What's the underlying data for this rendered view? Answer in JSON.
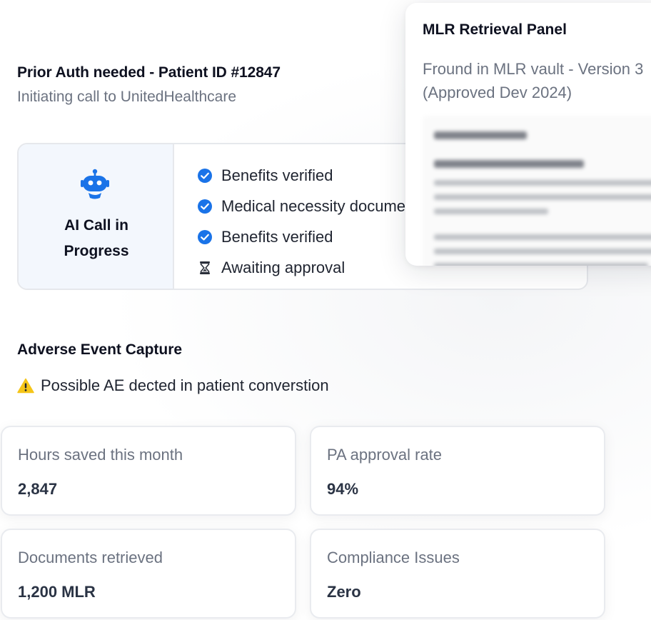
{
  "prior_auth": {
    "title": "Prior Auth needed - Patient ID #12847",
    "subtitle": "Initiating call to UnitedHealthcare"
  },
  "call_card": {
    "status_line1": "AI Call in",
    "status_line2": "Progress",
    "steps": [
      {
        "label": "Benefits verified",
        "icon": "check-circle-icon",
        "state": "done"
      },
      {
        "label": "Medical necessity documented",
        "icon": "check-circle-icon",
        "state": "done"
      },
      {
        "label": "Benefits verified",
        "icon": "check-circle-icon",
        "state": "done"
      },
      {
        "label": "Awaiting approval",
        "icon": "hourglass-icon",
        "state": "pending"
      }
    ]
  },
  "mlr_panel": {
    "title": "MLR Retrieval Panel",
    "found_line1": "Fround in MLR vault - Version 3",
    "found_line2": "(Approved Dev 2024)"
  },
  "adverse_event": {
    "title": "Adverse Event Capture",
    "alert": "Possible AE dected in patient converstion",
    "alert_icon": "warning-icon"
  },
  "stats": [
    {
      "label": "Hours saved this month",
      "value": "2,847"
    },
    {
      "label": "PA approval rate",
      "value": "94%"
    },
    {
      "label": "Documents retrieved",
      "value": "1,200 MLR"
    },
    {
      "label": "Compliance Issues",
      "value": "Zero"
    }
  ],
  "colors": {
    "accent_blue": "#1a73e8",
    "warning_yellow": "#f5c518",
    "muted_text": "#6b7280",
    "status_panel_bg": "#f3f7fd"
  }
}
